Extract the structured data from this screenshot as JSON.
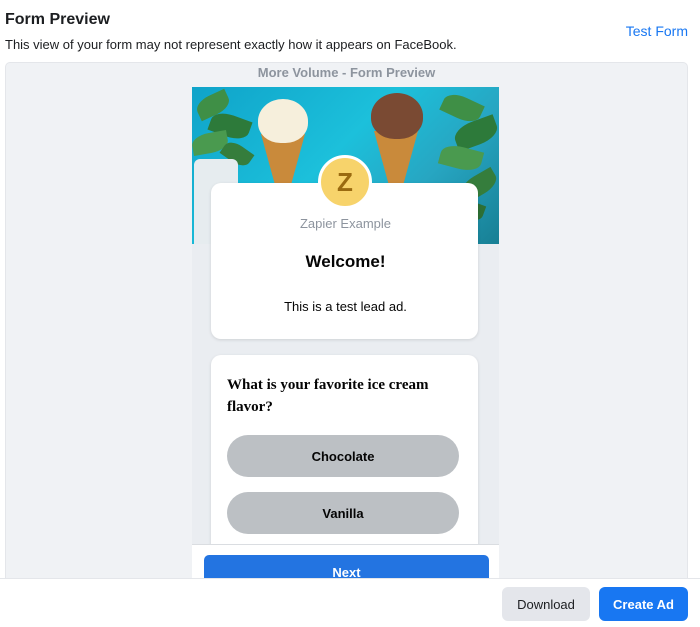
{
  "header": {
    "title": "Form Preview",
    "subtitle": "This view of your form may not represent exactly how it appears on FaceBook.",
    "test_form_link": "Test Form"
  },
  "preview": {
    "title": "More Volume - Form Preview",
    "page_avatar_letter": "Z",
    "page_name": "Zapier Example",
    "welcome_heading": "Welcome!",
    "welcome_body": "This is a test lead ad.",
    "question": "What is your favorite ice cream flavor?",
    "options": [
      "Chocolate",
      "Vanilla"
    ],
    "next_label": "Next"
  },
  "footer": {
    "download_label": "Download",
    "create_ad_label": "Create Ad"
  },
  "colors": {
    "accent": "#1877f2",
    "next_button": "#2374e1",
    "option_button": "#bcc0c4",
    "avatar": "#f7d36b"
  },
  "icons": [
    "ice-cream-cover-image",
    "page-avatar"
  ]
}
